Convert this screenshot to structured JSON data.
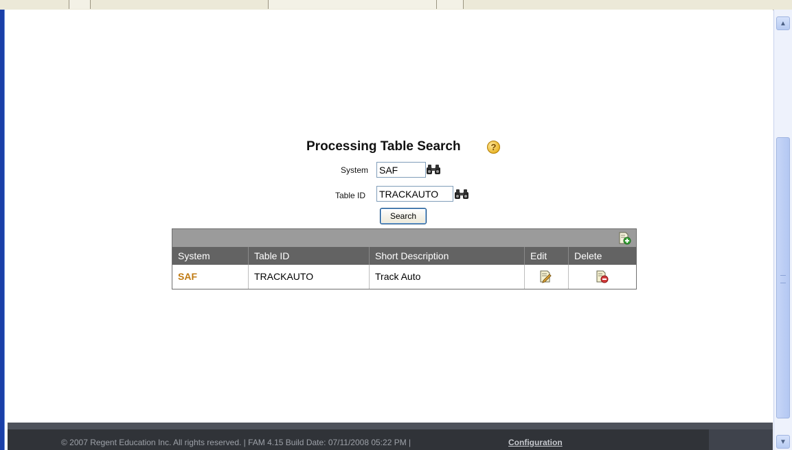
{
  "page": {
    "title": "Processing Table Search",
    "help_icon": "question-mark-icon"
  },
  "form": {
    "system_label": "System",
    "system_value": "SAF",
    "table_id_label": "Table ID",
    "table_id_value": "TRACKAUTO",
    "lookup_icon": "binoculars-icon",
    "search_label": "Search"
  },
  "table": {
    "add_icon": "add-document-icon",
    "columns": [
      "System",
      "Table ID",
      "Short Description",
      "Edit",
      "Delete"
    ],
    "rows": [
      {
        "system": "SAF",
        "table_id": "TRACKAUTO",
        "short_description": "Track Auto",
        "edit_icon": "edit-pencil-icon",
        "delete_icon": "delete-document-icon"
      }
    ]
  },
  "footer": {
    "copyright": "© 2007 Regent Education Inc. All rights reserved. | FAM 4.15 Build Date: 07/11/2008 05:22 PM |",
    "configuration_link": "Configuration"
  },
  "colors": {
    "link": "#c07a12",
    "header_bg": "#636363",
    "toolbar_bg": "#9b9b9b",
    "footer_bg": "#303338"
  }
}
